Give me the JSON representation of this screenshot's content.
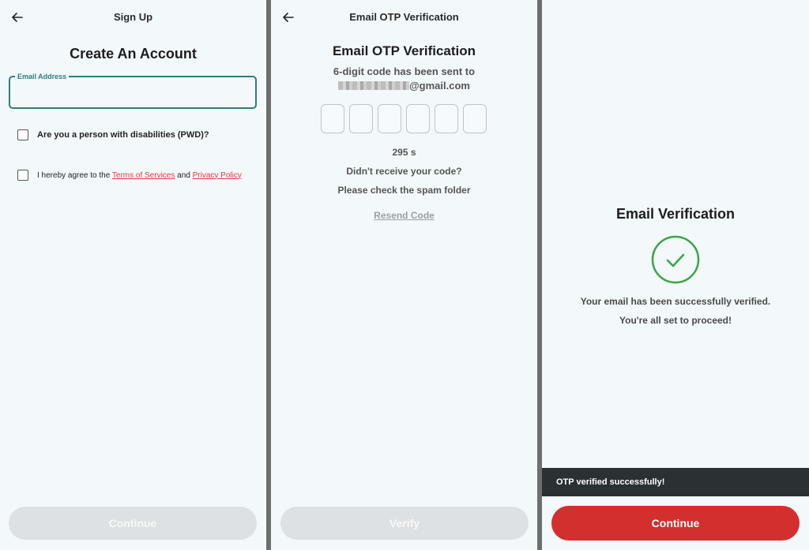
{
  "signup": {
    "topbar_title": "Sign Up",
    "heading": "Create An Account",
    "email_label": "Email Address",
    "email_value": "",
    "pwd_label": "Are you a person with disabilities (PWD)?",
    "agree_prefix": "I hereby agree to the ",
    "terms_link": "Terms of Services",
    "agree_and": " and ",
    "privacy_link": "Privacy Policy",
    "continue_label": "Continue"
  },
  "otp": {
    "topbar_title": "Email OTP Verification",
    "heading": "Email OTP Verification",
    "sent_text": "6-digit code has been sent to",
    "email_suffix": "@gmail.com",
    "digits": [
      "",
      "",
      "",
      "",
      "",
      ""
    ],
    "timer": "295 s",
    "not_received": "Didn't receive your code?",
    "check_spam": "Please check the spam folder",
    "resend_label": "Resend Code",
    "verify_label": "Verify"
  },
  "success": {
    "heading": "Email Verification",
    "message_1": "Your email has been successfully verified.",
    "message_2": "You're all set to proceed!",
    "toast": "OTP verified successfully!",
    "continue_label": "Continue"
  },
  "colors": {
    "accent_teal": "#2f7d7d",
    "link_red": "#e03a3a",
    "button_red": "#d42f2f",
    "success_green": "#3aa546",
    "disabled_button": "#dde1e3",
    "toast_bg": "#2b3033"
  }
}
